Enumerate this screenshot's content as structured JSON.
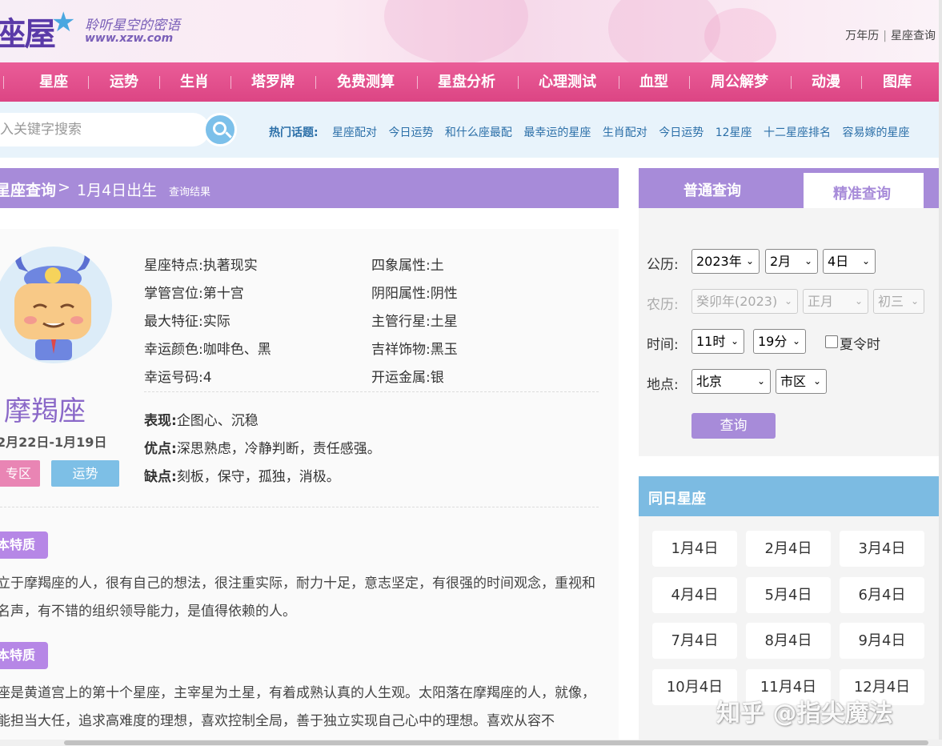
{
  "header": {
    "logo_text": "座屋",
    "slogan": "聆听星空的密语",
    "site_url": "www.xzw.com",
    "top_links": [
      "万年历",
      "星座查询"
    ],
    "top_sep": "|"
  },
  "nav": {
    "items": [
      "星座",
      "运势",
      "生肖",
      "塔罗牌",
      "免费测算",
      "星盘分析",
      "心理测试",
      "血型",
      "周公解梦",
      "动漫",
      "图库"
    ]
  },
  "search": {
    "placeholder": "入关键字搜索",
    "hot_label": "热门话题:",
    "hot_links": [
      "星座配对",
      "今日运势",
      "和什么座最配",
      "最幸运的星座",
      "生肖配对",
      "今日运势",
      "12星座",
      "十二星座排名",
      "容易嫁的星座"
    ]
  },
  "breadcrumb": {
    "root": "星座查询",
    "arrow": ">",
    "current": "1月4日出生",
    "suffix": "查询结果"
  },
  "sign": {
    "name": "摩羯座",
    "date_range": "2月22日-1月19日",
    "zone_button": "专区",
    "luck_button": "运势",
    "attributes_left": [
      {
        "label": "星座特点:",
        "value": "执著现实"
      },
      {
        "label": "掌管宫位:",
        "value": "第十宫"
      },
      {
        "label": "最大特征:",
        "value": "实际"
      },
      {
        "label": "幸运颜色:",
        "value": "咖啡色、黑"
      },
      {
        "label": "幸运号码:",
        "value": "4"
      }
    ],
    "attributes_right": [
      {
        "label": "四象属性:",
        "value": "土"
      },
      {
        "label": "阴阳属性:",
        "value": "阴性"
      },
      {
        "label": "主管行星:",
        "value": "土星"
      },
      {
        "label": "吉祥饰物:",
        "value": "黑玉"
      },
      {
        "label": "开运金属:",
        "value": "银"
      }
    ],
    "traits": [
      {
        "label": "表现:",
        "value": "企图心、沉稳"
      },
      {
        "label": "优点:",
        "value": "深思熟虑，冷静判断，责任感强。"
      },
      {
        "label": "缺点:",
        "value": "刻板，保守，孤独，消极。"
      }
    ],
    "sections": [
      {
        "tag": "本特质",
        "text": "立于摩羯座的人，很有自己的想法，很注重实际，耐力十足，意志坚定，有很强的时间观念，重视和名声，有不错的组织领导能力，是值得依赖的人。"
      },
      {
        "tag": "本特质",
        "text": "座是黄道宫上的第十个星座，主宰星为土星，有着成熟认真的人生观。太阳落在摩羯座的人，就像，能担当大任，追求高难度的理想，喜欢控制全局，善于独立实现自己心中的理想。喜欢从容不"
      }
    ]
  },
  "query_panel": {
    "tab_normal": "普通查询",
    "tab_precise": "精准查询",
    "solar_label": "公历:",
    "solar_year": "2023年",
    "solar_month": "2月",
    "solar_day": "4日",
    "lunar_label": "农历:",
    "lunar_year": "癸卯年(2023)",
    "lunar_month": "正月",
    "lunar_day": "初三",
    "time_label": "时间:",
    "hour": "11时",
    "minute": "19分",
    "dst_label": "夏令时",
    "place_label": "地点:",
    "city": "北京",
    "district": "市区",
    "query_button": "查询"
  },
  "same_day": {
    "title": "同日星座",
    "days": [
      "1月4日",
      "2月4日",
      "3月4日",
      "4月4日",
      "5月4日",
      "6月4日",
      "7月4日",
      "8月4日",
      "9月4日",
      "10月4日",
      "11月4日",
      "12月4日"
    ]
  },
  "watermark": "知乎 @指尖魔法",
  "colors": {
    "nav_pink": "#e34d8c",
    "purple": "#a78bd9",
    "blue": "#7cbbe2",
    "search_bg": "#e8f3fb"
  }
}
